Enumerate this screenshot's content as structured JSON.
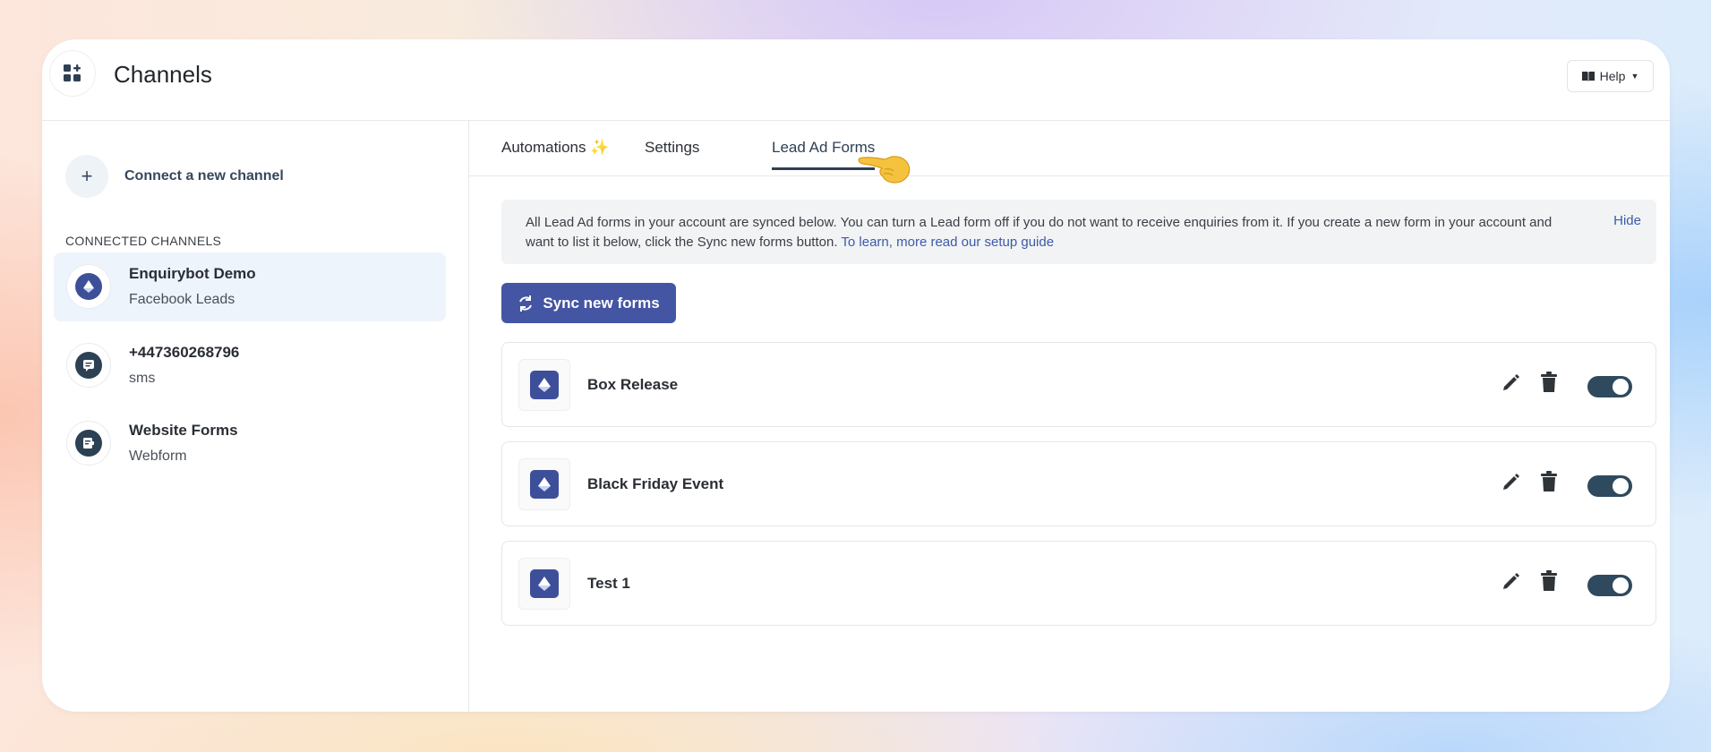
{
  "header": {
    "title": "Channels",
    "help_label": "Help",
    "help_icon": "book-icon"
  },
  "sidebar": {
    "connect_label": "Connect a new channel",
    "section_label": "CONNECTED CHANNELS",
    "channels": [
      {
        "name": "Enquirybot Demo",
        "sub": "Facebook Leads",
        "icon": "facebook-leads-icon",
        "active": true
      },
      {
        "name": "+447360268796",
        "sub": "sms",
        "icon": "sms-icon",
        "active": false
      },
      {
        "name": "Website Forms",
        "sub": "Webform",
        "icon": "webform-icon",
        "active": false
      }
    ]
  },
  "tabs": [
    {
      "label": "Automations ✨"
    },
    {
      "label": "Settings"
    },
    {
      "label": "Lead Ad Forms",
      "active": true
    }
  ],
  "notice": {
    "text": "All Lead Ad forms in your account are synced below. You can turn a Lead form off if you do not want to receive enquiries from it. If you create a new form in your account and want to list it below, click the Sync new forms button.",
    "link": "To learn, more read our setup guide",
    "hide": "Hide"
  },
  "sync_button": {
    "label": "Sync new forms"
  },
  "forms": [
    {
      "name": "Box Release",
      "enabled": true
    },
    {
      "name": "Black Friday Event",
      "enabled": true
    },
    {
      "name": "Test 1",
      "enabled": true
    }
  ],
  "colors": {
    "accent": "#4455a3",
    "toggle_on": "#2f4a5e",
    "active_channel_bg": "#eef4fb"
  }
}
